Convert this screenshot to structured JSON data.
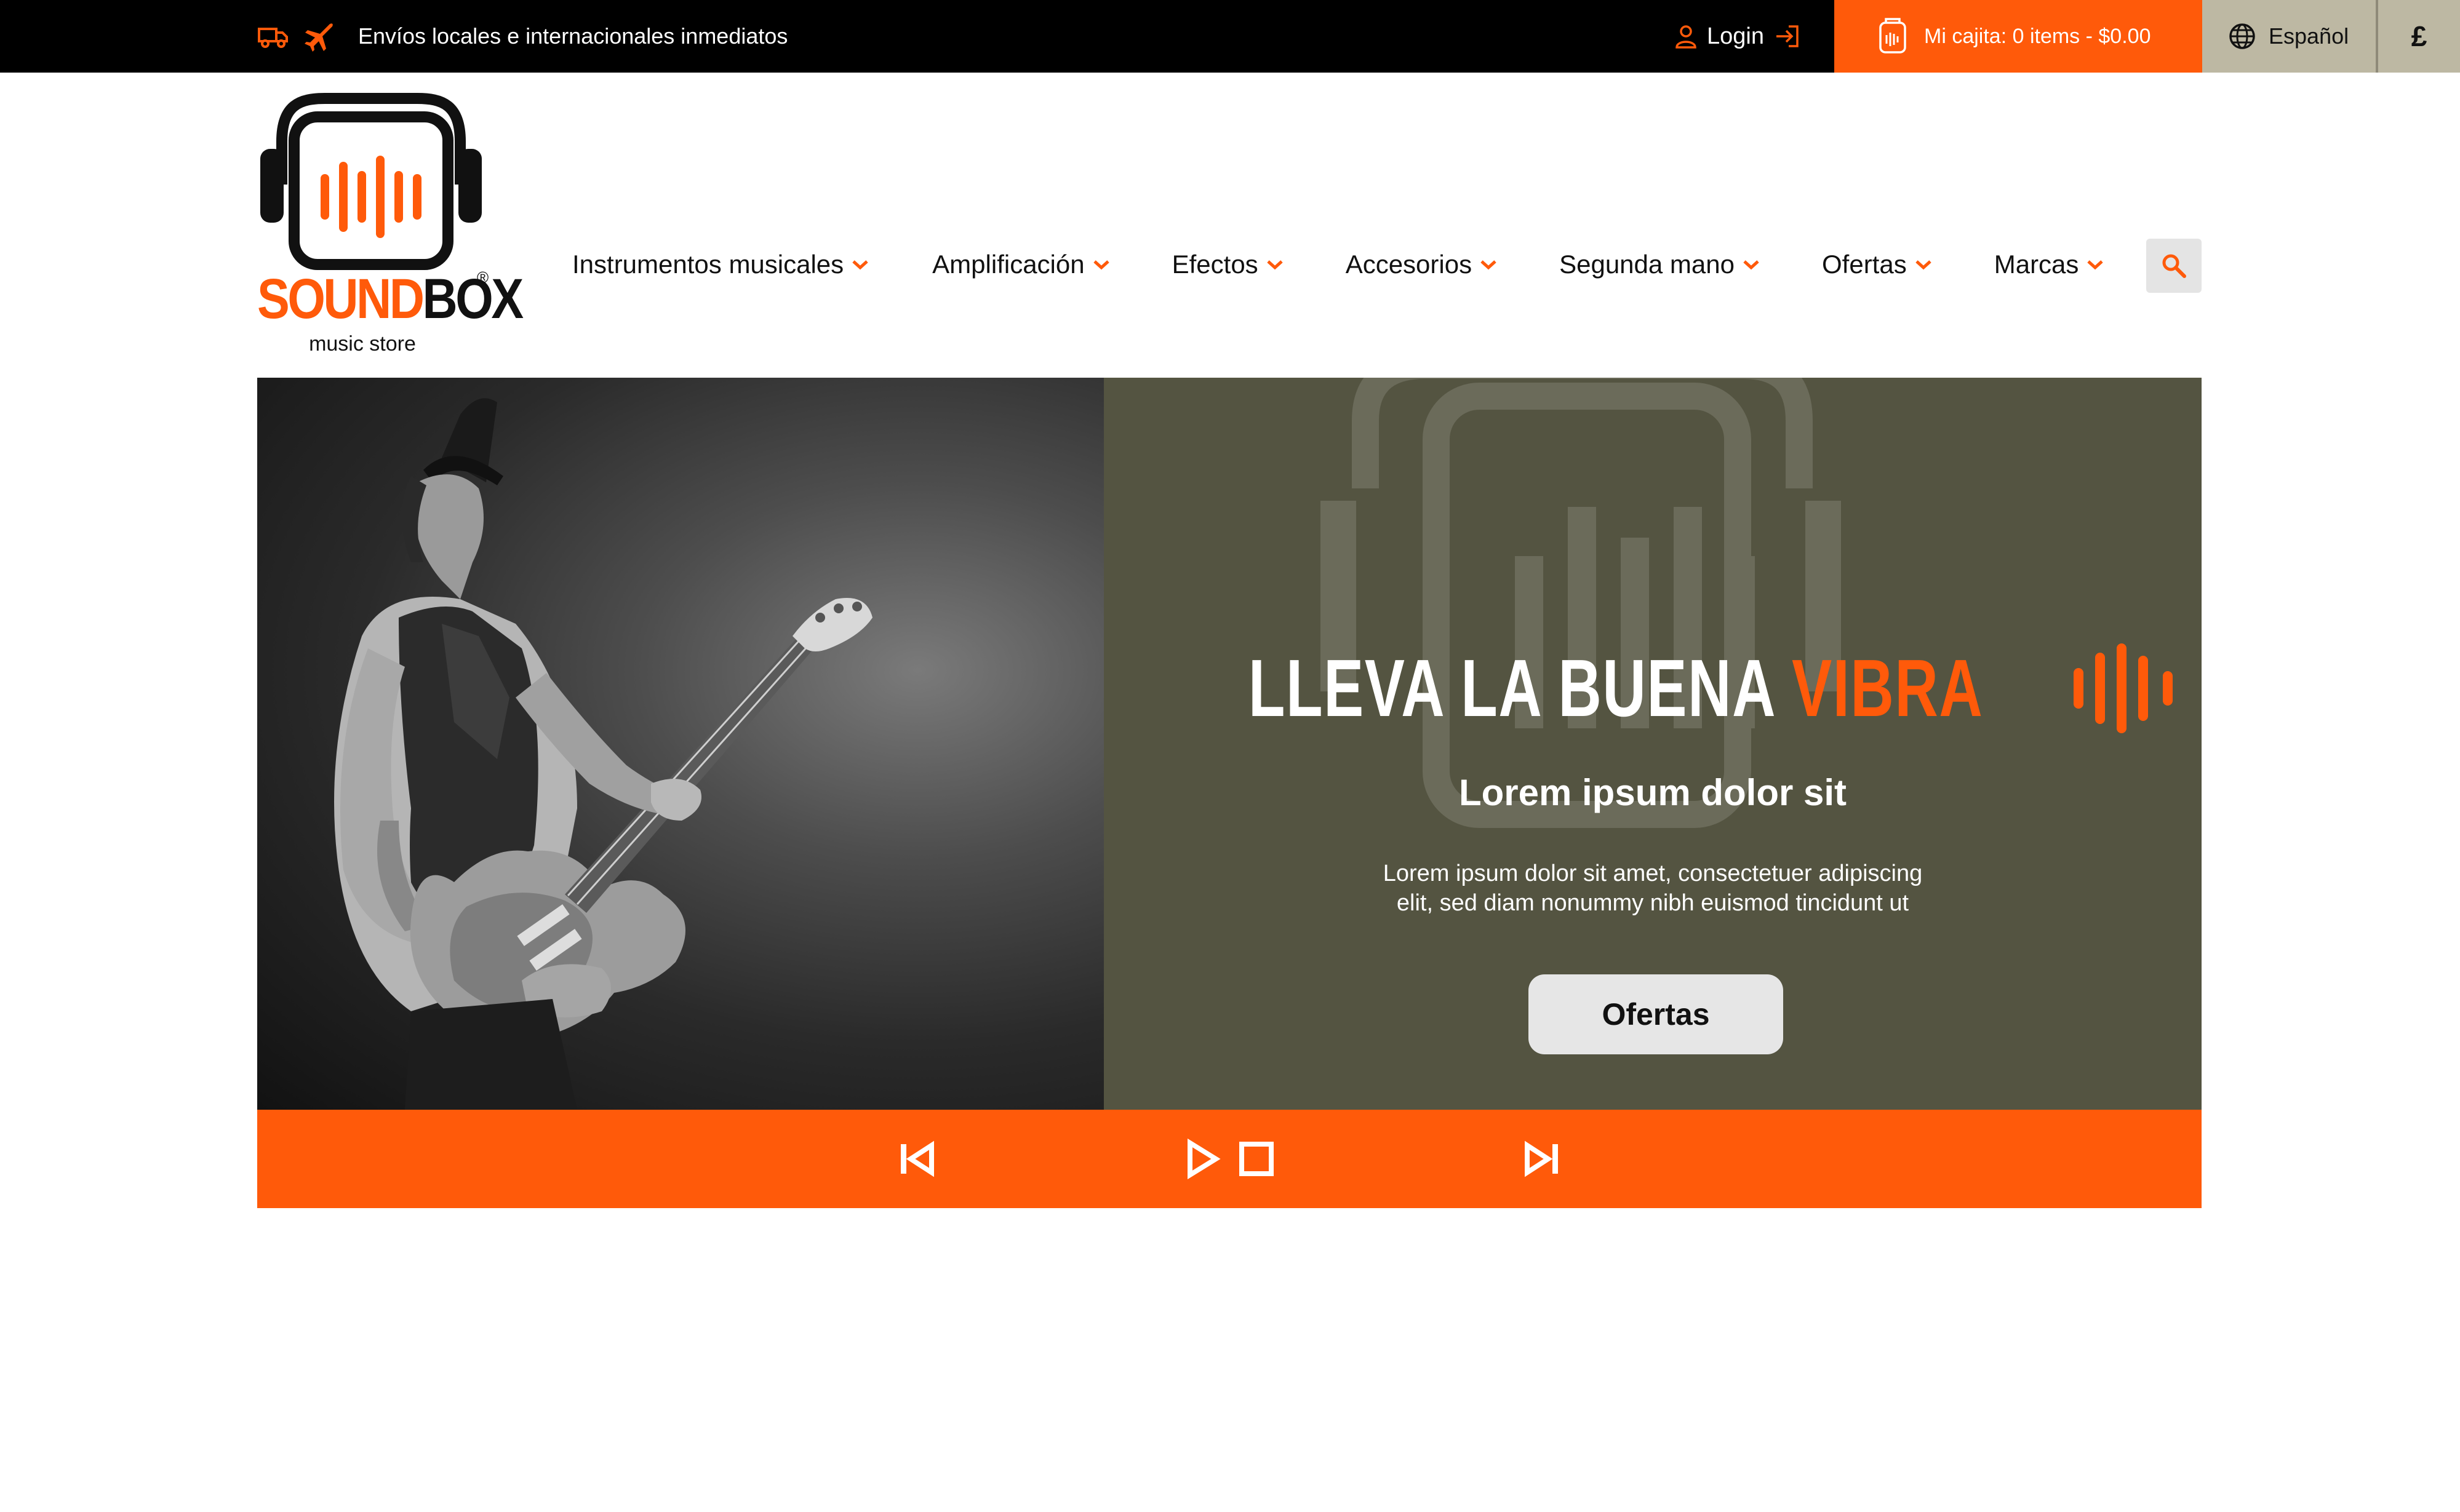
{
  "topbar": {
    "shipping_text": "Envíos locales e internacionales inmediatos",
    "login_label": "Login",
    "cart_label": "Mi cajita: 0 items - $0.00",
    "language_label": "Español",
    "currency_symbol": "£"
  },
  "logo": {
    "word_sound": "SOUND",
    "word_box": "BOX",
    "registered": "®",
    "tagline": "music store"
  },
  "nav": {
    "items": [
      {
        "label": "Instrumentos musicales"
      },
      {
        "label": "Amplificación"
      },
      {
        "label": "Efectos"
      },
      {
        "label": "Accesorios"
      },
      {
        "label": "Segunda mano"
      },
      {
        "label": "Ofertas"
      },
      {
        "label": "Marcas"
      }
    ],
    "search_icon": "search-icon"
  },
  "hero": {
    "headline_main": "LLEVA LA BUENA ",
    "headline_accent": "VIBRA",
    "subtitle": "Lorem ipsum dolor sit",
    "body_line1": "Lorem ipsum dolor sit amet, consectetuer adipiscing",
    "body_line2": "elit, sed diam nonummy nibh euismod tincidunt ut",
    "cta_label": "Ofertas"
  },
  "player": {
    "controls": [
      "previous-icon",
      "play-icon",
      "stop-icon",
      "next-icon"
    ]
  },
  "colors": {
    "accent": "#ff5a0a",
    "topbar_bg": "#000000",
    "promo_bg": "#545441",
    "lang_bg": "#bdb8a3",
    "button_bg": "#e6e6e6"
  }
}
